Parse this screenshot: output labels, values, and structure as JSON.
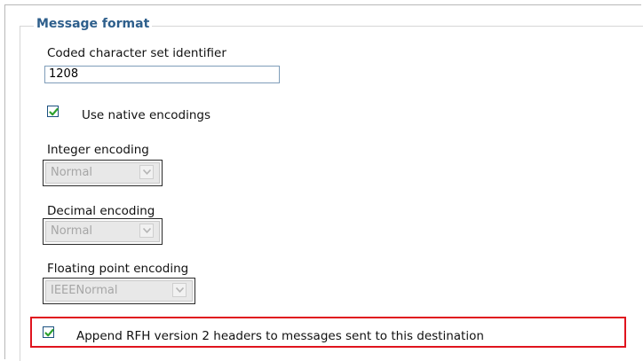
{
  "section": {
    "legend": "Message format"
  },
  "ccsid": {
    "label": "Coded character set identifier",
    "value": "1208"
  },
  "native_encodings": {
    "label": "Use native encodings",
    "checked": true
  },
  "integer_encoding": {
    "label": "Integer encoding",
    "value": "Normal",
    "disabled": true
  },
  "decimal_encoding": {
    "label": "Decimal encoding",
    "value": "Normal",
    "disabled": true
  },
  "floating_point_encoding": {
    "label": "Floating point encoding",
    "value": "IEEENormal",
    "disabled": true
  },
  "append_rfh": {
    "label": "Append RFH version 2 headers to messages sent to this destination",
    "checked": true
  },
  "colors": {
    "legend": "#2e5f8c",
    "highlight_border": "#e0141e",
    "checkmark": "#2ea12e"
  },
  "icons": {
    "checkbox": "checkmark-icon",
    "dropdown": "chevron-down-icon"
  }
}
